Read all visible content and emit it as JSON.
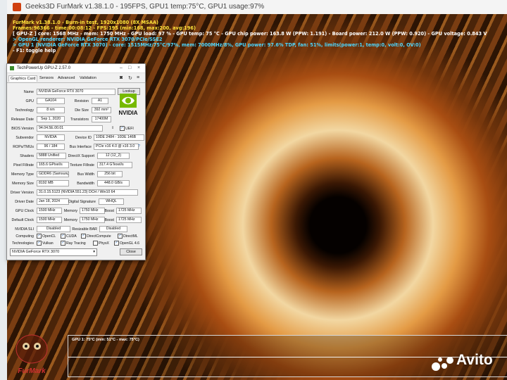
{
  "titlebar": {
    "title": "Geeks3D FurMark v1.38.1.0 - 195FPS, GPU1 temp:75°C, GPU1 usage:97%"
  },
  "overlay": {
    "lines": [
      "FurMark v1.38.1.0 - Burn-in test, 1920x1080 (8X MSAA)",
      "Frames:96366 - time:00:08:12 - FPS:195 (min:168, max:200, avg:196)",
      "[ GPU-Z ] core: 1568 MHz - mem: 1750 MHz - GPU load: 97 % - GPU temp: 75 °C - GPU chip power: 163.8 W (PPW: 1.191) - Board power: 212.0 W (PPW: 0.920) - GPU voltage: 0.843 V",
      "> OpenGL renderer: NVIDIA GeForce RTX 3070/PCIe/SSE2",
      "> GPU 1 (NVIDIA GeForce RTX 3070) - core: 1515MHz/75°C/97%, mem: 7000MHz/8%, GPU power: 97.6% TDP, fan: 51%, limits(power:1, temp:0, volt:0, OV:0)",
      "- F1: toggle help"
    ]
  },
  "gpuz": {
    "window_title": "TechPowerUp GPU-Z 2.57.0",
    "tabs": [
      "Graphics Card",
      "Sensors",
      "Advanced",
      "Validation"
    ],
    "lookup_label": "Lookup",
    "labels": {
      "name": "Name",
      "gpu": "GPU",
      "revision": "Revision",
      "technology": "Technology",
      "die_size": "Die Size",
      "release_date": "Release Date",
      "transistors": "Transistors",
      "bios_version": "BIOS Version",
      "uefi": "UEFI",
      "subvendor": "Subvendor",
      "device_id": "Device ID",
      "rops_tmus": "ROPs/TMUs",
      "bus_interface": "Bus Interface",
      "shaders": "Shaders",
      "directx_support": "DirectX Support",
      "pixel_fillrate": "Pixel Fillrate",
      "texture_fillrate": "Texture Fillrate",
      "memory_type": "Memory Type",
      "bus_width": "Bus Width",
      "memory_size": "Memory Size",
      "bandwidth": "Bandwidth",
      "driver_version": "Driver Version",
      "driver_date": "Driver Date",
      "digital_signature": "Digital Signature",
      "gpu_clock": "GPU Clock",
      "memory": "Memory",
      "boost": "Boost",
      "default_clock": "Default Clock",
      "nvidia_sli": "NVIDIA SLI",
      "resizable_bar": "Resizable BAR",
      "computing": "Computing",
      "technologies": "Technologies"
    },
    "values": {
      "name": "NVIDIA GeForce RTX 3070",
      "gpu": "GA104",
      "revision": "A1",
      "technology": "8 nm",
      "die_size": "392 mm²",
      "release_date": "Sep 1, 2020",
      "transistors": "17400M",
      "bios_version": "94.04.5E.00.01",
      "subvendor": "NVIDIA",
      "device_id": "10DE 2484 - 10DE 146B",
      "rops_tmus": "96 / 184",
      "bus_interface": "PCIe x16 4.0 @ x16 3.0",
      "shaders": "5888 Unified",
      "directx_support": "12 (12_2)",
      "pixel_fillrate": "165.6 GPixel/s",
      "texture_fillrate": "317.4 GTexel/s",
      "memory_type": "GDDR6 (Samsung)",
      "bus_width": "256 bit",
      "memory_size": "8192 MB",
      "bandwidth": "448.0 GB/s",
      "driver_version": "31.0.15.5123 (NVIDIA 551.23) DCH / Win10 64",
      "driver_date": "Jan 18, 2024",
      "digital_signature": "WHQL",
      "gpu_clock": "1500 MHz",
      "gpu_memory": "1750 MHz",
      "gpu_boost": "1725 MHz",
      "default_clock": "1500 MHz",
      "default_memory": "1750 MHz",
      "default_boost": "1725 MHz",
      "nvidia_sli": "Disabled",
      "resizable_bar": "Disabled"
    },
    "computing": [
      "OpenCL",
      "CUDA",
      "DirectCompute",
      "DirectML"
    ],
    "technologies": [
      "Vulkan",
      "Ray Tracing",
      "PhysX",
      "OpenGL 4.6"
    ],
    "gpu_select": "NVIDIA GeForce RTX 3070",
    "close_label": "Close",
    "nvidia_logo_text": "NVIDIA"
  },
  "graph": {
    "label": "GPU 1: 75°C (min: 51°C - max: 75°C)"
  },
  "brand": {
    "furmark_logo_text": "FurMark",
    "watermark": "Avito"
  },
  "colors": {
    "overlay_yellow": "#ffe23a",
    "overlay_cyan": "#4cd6ff",
    "nvidia_green": "#76b900"
  }
}
